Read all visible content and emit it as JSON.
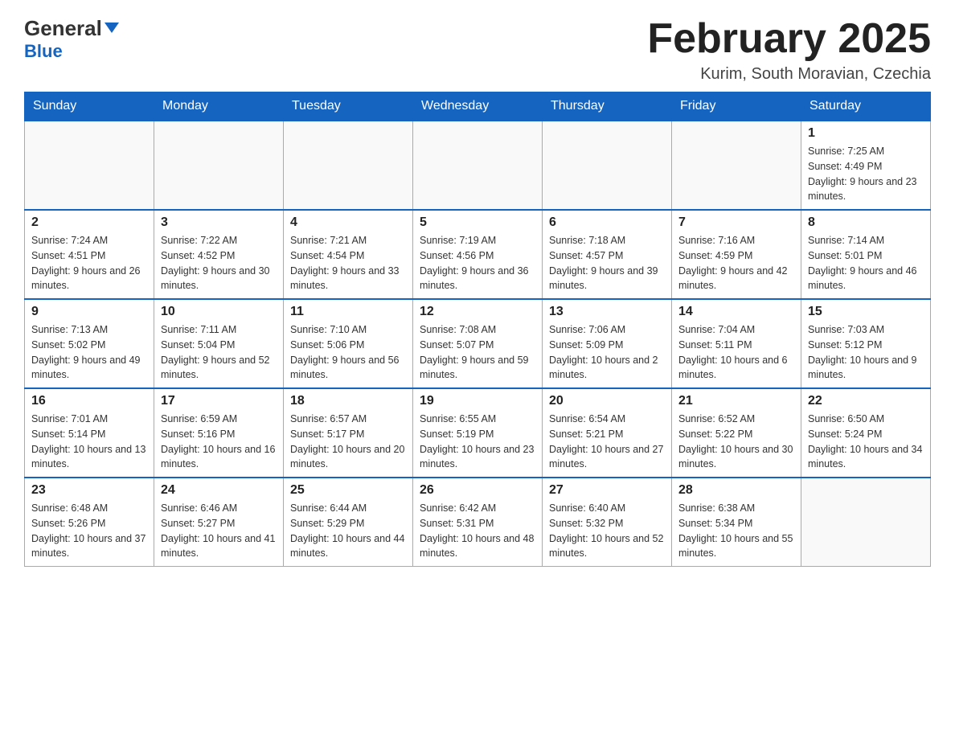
{
  "header": {
    "logo": {
      "general": "General",
      "blue": "Blue"
    },
    "title": "February 2025",
    "location": "Kurim, South Moravian, Czechia"
  },
  "calendar": {
    "weekdays": [
      "Sunday",
      "Monday",
      "Tuesday",
      "Wednesday",
      "Thursday",
      "Friday",
      "Saturday"
    ],
    "weeks": [
      [
        {
          "day": "",
          "info": ""
        },
        {
          "day": "",
          "info": ""
        },
        {
          "day": "",
          "info": ""
        },
        {
          "day": "",
          "info": ""
        },
        {
          "day": "",
          "info": ""
        },
        {
          "day": "",
          "info": ""
        },
        {
          "day": "1",
          "info": "Sunrise: 7:25 AM\nSunset: 4:49 PM\nDaylight: 9 hours and 23 minutes."
        }
      ],
      [
        {
          "day": "2",
          "info": "Sunrise: 7:24 AM\nSunset: 4:51 PM\nDaylight: 9 hours and 26 minutes."
        },
        {
          "day": "3",
          "info": "Sunrise: 7:22 AM\nSunset: 4:52 PM\nDaylight: 9 hours and 30 minutes."
        },
        {
          "day": "4",
          "info": "Sunrise: 7:21 AM\nSunset: 4:54 PM\nDaylight: 9 hours and 33 minutes."
        },
        {
          "day": "5",
          "info": "Sunrise: 7:19 AM\nSunset: 4:56 PM\nDaylight: 9 hours and 36 minutes."
        },
        {
          "day": "6",
          "info": "Sunrise: 7:18 AM\nSunset: 4:57 PM\nDaylight: 9 hours and 39 minutes."
        },
        {
          "day": "7",
          "info": "Sunrise: 7:16 AM\nSunset: 4:59 PM\nDaylight: 9 hours and 42 minutes."
        },
        {
          "day": "8",
          "info": "Sunrise: 7:14 AM\nSunset: 5:01 PM\nDaylight: 9 hours and 46 minutes."
        }
      ],
      [
        {
          "day": "9",
          "info": "Sunrise: 7:13 AM\nSunset: 5:02 PM\nDaylight: 9 hours and 49 minutes."
        },
        {
          "day": "10",
          "info": "Sunrise: 7:11 AM\nSunset: 5:04 PM\nDaylight: 9 hours and 52 minutes."
        },
        {
          "day": "11",
          "info": "Sunrise: 7:10 AM\nSunset: 5:06 PM\nDaylight: 9 hours and 56 minutes."
        },
        {
          "day": "12",
          "info": "Sunrise: 7:08 AM\nSunset: 5:07 PM\nDaylight: 9 hours and 59 minutes."
        },
        {
          "day": "13",
          "info": "Sunrise: 7:06 AM\nSunset: 5:09 PM\nDaylight: 10 hours and 2 minutes."
        },
        {
          "day": "14",
          "info": "Sunrise: 7:04 AM\nSunset: 5:11 PM\nDaylight: 10 hours and 6 minutes."
        },
        {
          "day": "15",
          "info": "Sunrise: 7:03 AM\nSunset: 5:12 PM\nDaylight: 10 hours and 9 minutes."
        }
      ],
      [
        {
          "day": "16",
          "info": "Sunrise: 7:01 AM\nSunset: 5:14 PM\nDaylight: 10 hours and 13 minutes."
        },
        {
          "day": "17",
          "info": "Sunrise: 6:59 AM\nSunset: 5:16 PM\nDaylight: 10 hours and 16 minutes."
        },
        {
          "day": "18",
          "info": "Sunrise: 6:57 AM\nSunset: 5:17 PM\nDaylight: 10 hours and 20 minutes."
        },
        {
          "day": "19",
          "info": "Sunrise: 6:55 AM\nSunset: 5:19 PM\nDaylight: 10 hours and 23 minutes."
        },
        {
          "day": "20",
          "info": "Sunrise: 6:54 AM\nSunset: 5:21 PM\nDaylight: 10 hours and 27 minutes."
        },
        {
          "day": "21",
          "info": "Sunrise: 6:52 AM\nSunset: 5:22 PM\nDaylight: 10 hours and 30 minutes."
        },
        {
          "day": "22",
          "info": "Sunrise: 6:50 AM\nSunset: 5:24 PM\nDaylight: 10 hours and 34 minutes."
        }
      ],
      [
        {
          "day": "23",
          "info": "Sunrise: 6:48 AM\nSunset: 5:26 PM\nDaylight: 10 hours and 37 minutes."
        },
        {
          "day": "24",
          "info": "Sunrise: 6:46 AM\nSunset: 5:27 PM\nDaylight: 10 hours and 41 minutes."
        },
        {
          "day": "25",
          "info": "Sunrise: 6:44 AM\nSunset: 5:29 PM\nDaylight: 10 hours and 44 minutes."
        },
        {
          "day": "26",
          "info": "Sunrise: 6:42 AM\nSunset: 5:31 PM\nDaylight: 10 hours and 48 minutes."
        },
        {
          "day": "27",
          "info": "Sunrise: 6:40 AM\nSunset: 5:32 PM\nDaylight: 10 hours and 52 minutes."
        },
        {
          "day": "28",
          "info": "Sunrise: 6:38 AM\nSunset: 5:34 PM\nDaylight: 10 hours and 55 minutes."
        },
        {
          "day": "",
          "info": ""
        }
      ]
    ]
  }
}
